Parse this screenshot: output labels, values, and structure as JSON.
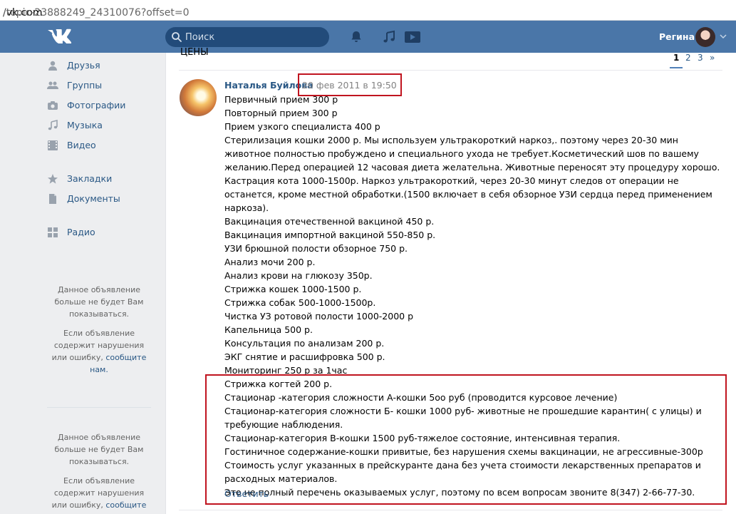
{
  "browser": {
    "url_domain": "/vk.com",
    "url_path": "/topic-23888249_24310076?offset=0"
  },
  "header": {
    "search_placeholder": "Поиск",
    "user_name": "Регина",
    "brand_color": "#4a76a8"
  },
  "sidebar": {
    "items": [
      {
        "label": "Друзья",
        "icon": "friends-icon"
      },
      {
        "label": "Группы",
        "icon": "groups-icon"
      },
      {
        "label": "Фотографии",
        "icon": "camera-icon"
      },
      {
        "label": "Музыка",
        "icon": "music-icon"
      },
      {
        "label": "Видео",
        "icon": "video-icon"
      },
      {
        "label": "Закладки",
        "icon": "star-icon"
      },
      {
        "label": "Документы",
        "icon": "document-icon"
      },
      {
        "label": "Радио",
        "icon": "radio-icon"
      }
    ],
    "ads": [
      {
        "hidden_text": "Данное объявление больше не будет Вам показываться.",
        "report_text": "Если объявление содержит нарушения или ошибку,",
        "report_link": "сообщите нам."
      },
      {
        "hidden_text": "Данное объявление больше не будет Вам показываться.",
        "report_text": "Если объявление содержит нарушения или ошибку,",
        "report_link": "сообщите"
      }
    ]
  },
  "topic": {
    "title_fragment": "ЦЕНЫ",
    "pages": [
      "1",
      "2",
      "3",
      "»"
    ],
    "current_page": "1"
  },
  "post": {
    "author": "Наталья Буйлова",
    "date": "20 фев 2011 в 19:50",
    "reply_label": "Ответить",
    "lines": [
      "Первичный прием 300 р",
      "Повторный прием 300 р",
      "Прием узкого специалиста 400 р",
      "Стерилизация кошки 2000 р. Мы используем ультракороткий наркоз,. поэтому через 20-30 мин животное полностью пробуждено и специального ухода не требует.Косметический шов по вашему желанию.Перед операцией 12 часовая диета желательна. Животные переносят эту процедуру хорошо.",
      "Кастрация кота 1000-1500р. Наркоз ультракороткий, через 20-30 минут следов от операции не останется, кроме местной обработки.(1500 включает в себя обзорное УЗИ сердца перед применением наркоза).",
      "Вакцинация отечественной вакциной 450 р.",
      "Вакцинация импортной вакциной 550-850 р.",
      "УЗИ брюшной полости обзорное 750 р.",
      "Анализ мочи 200 р.",
      "Анализ крови на глюкозу 350р.",
      "Стрижка кошек 1000-1500 р.",
      "Стрижка собак 500-1000-1500р.",
      "Чистка УЗ ротовой полости 1000-2000 р",
      "Капельница 500 р.",
      "Консультация по анализам 200 р.",
      "ЭКГ снятие и расшифровка 500 р.",
      "Мониторинг 250 р за 1час",
      "Стрижка когтей 200 р.",
      "Стационар -категория сложности А-кошки 5оо руб (проводится курсовое лечение)",
      "Стационар-категория сложности Б- кошки 1000 руб- животные не прошедшие карантин( с улицы) и требующие наблюдения.",
      "Стационар-категория В-кошки 1500 руб-тяжелое состояние, интенсивная терапия.",
      "Гостиничное содержание-кошки привитые, без нарушения схемы вакцинации, не агрессивные-300р",
      "Стоимость услуг указанных в прейскуранте дана без учета стоимости лекарственных препаратов и расходных материалов.",
      "Это не полный перечень оказываемых услуг, поэтому по всем вопросам звоните 8(347) 2-66-77-30."
    ]
  },
  "annotation_color": "#c0141f"
}
